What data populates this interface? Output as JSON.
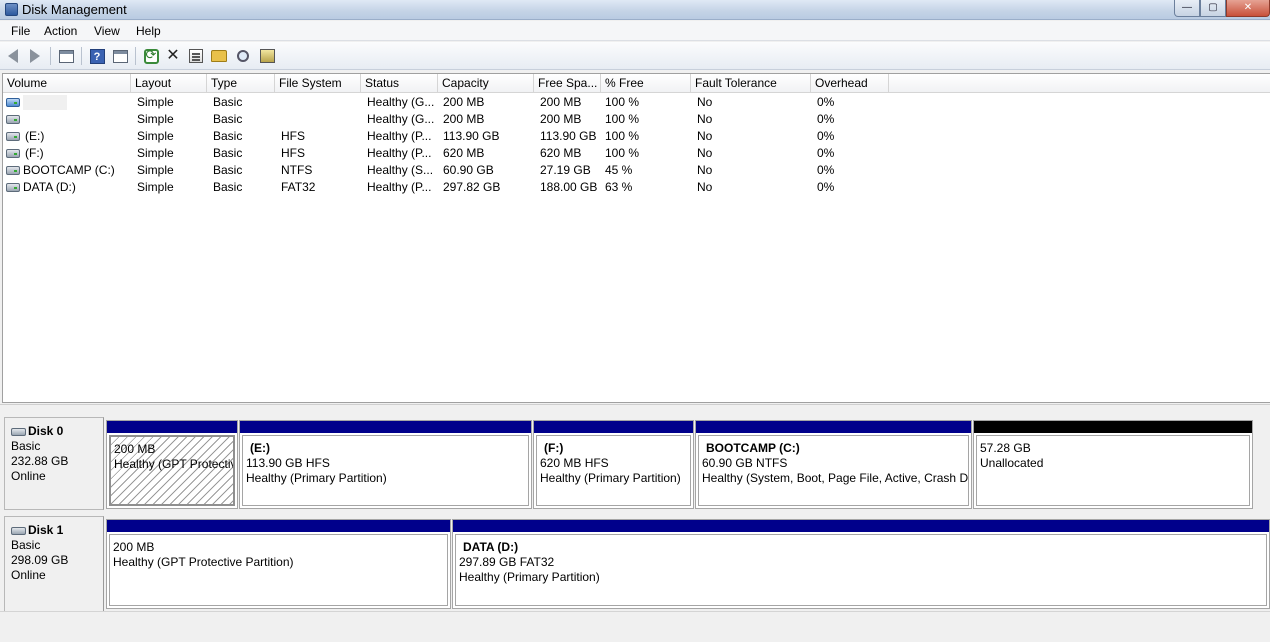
{
  "window": {
    "title": "Disk Management",
    "buttons": {
      "minimize": "—",
      "maximize": "▢",
      "close": "✕"
    }
  },
  "menu": [
    "File",
    "Action",
    "View",
    "Help"
  ],
  "toolbar": [
    "back-icon",
    "forward-icon",
    "console-tree-icon",
    "help-icon",
    "action-pane-icon",
    "refresh-icon",
    "delete-icon",
    "properties-icon",
    "open-icon",
    "search-icon",
    "disk-icon"
  ],
  "columns": [
    "Volume",
    "Layout",
    "Type",
    "File System",
    "Status",
    "Capacity",
    "Free Spa...",
    "% Free",
    "Fault Tolerance",
    "Overhead"
  ],
  "volumes": [
    {
      "volume": "",
      "layout": "Simple",
      "type": "Basic",
      "fs": "",
      "status": "Healthy (G...",
      "capacity": "200 MB",
      "free": "200 MB",
      "pct": "100 %",
      "fault": "No",
      "overhead": "0%"
    },
    {
      "volume": "",
      "layout": "Simple",
      "type": "Basic",
      "fs": "",
      "status": "Healthy (G...",
      "capacity": "200 MB",
      "free": "200 MB",
      "pct": "100 %",
      "fault": "No",
      "overhead": "0%"
    },
    {
      "volume": "(E:)",
      "layout": "Simple",
      "type": "Basic",
      "fs": "HFS",
      "status": "Healthy (P...",
      "capacity": "113.90 GB",
      "free": "113.90 GB",
      "pct": "100 %",
      "fault": "No",
      "overhead": "0%"
    },
    {
      "volume": "(F:)",
      "layout": "Simple",
      "type": "Basic",
      "fs": "HFS",
      "status": "Healthy (P...",
      "capacity": "620 MB",
      "free": "620 MB",
      "pct": "100 %",
      "fault": "No",
      "overhead": "0%"
    },
    {
      "volume": "BOOTCAMP (C:)",
      "layout": "Simple",
      "type": "Basic",
      "fs": "NTFS",
      "status": "Healthy (S...",
      "capacity": "60.90 GB",
      "free": "27.19 GB",
      "pct": "45 %",
      "fault": "No",
      "overhead": "0%"
    },
    {
      "volume": "DATA (D:)",
      "layout": "Simple",
      "type": "Basic",
      "fs": "FAT32",
      "status": "Healthy (P...",
      "capacity": "297.82 GB",
      "free": "188.00 GB",
      "pct": "63 %",
      "fault": "No",
      "overhead": "0%"
    }
  ],
  "disks": [
    {
      "name": "Disk 0",
      "kind": "Basic",
      "size": "232.88 GB",
      "state": "Online",
      "partitions": [
        {
          "name": "",
          "line1": "200 MB",
          "line2": "Healthy (GPT Protective Partition)"
        },
        {
          "name": "(E:)",
          "line1": "113.90 GB HFS",
          "line2": "Healthy (Primary Partition)"
        },
        {
          "name": "(F:)",
          "line1": "620 MB HFS",
          "line2": "Healthy (Primary Partition)"
        },
        {
          "name": "BOOTCAMP  (C:)",
          "line1": "60.90 GB NTFS",
          "line2": "Healthy (System, Boot, Page File, Active, Crash Du"
        },
        {
          "name": "",
          "line1": "57.28 GB",
          "line2": "Unallocated"
        }
      ]
    },
    {
      "name": "Disk 1",
      "kind": "Basic",
      "size": "298.09 GB",
      "state": "Online",
      "partitions": [
        {
          "name": "",
          "line1": "200 MB",
          "line2": "Healthy (GPT Protective Partition)"
        },
        {
          "name": "DATA  (D:)",
          "line1": "297.89 GB FAT32",
          "line2": "Healthy (Primary Partition)"
        }
      ]
    }
  ],
  "colors": {
    "primary_partition_band": "#00008b",
    "unallocated_band": "#000000"
  }
}
